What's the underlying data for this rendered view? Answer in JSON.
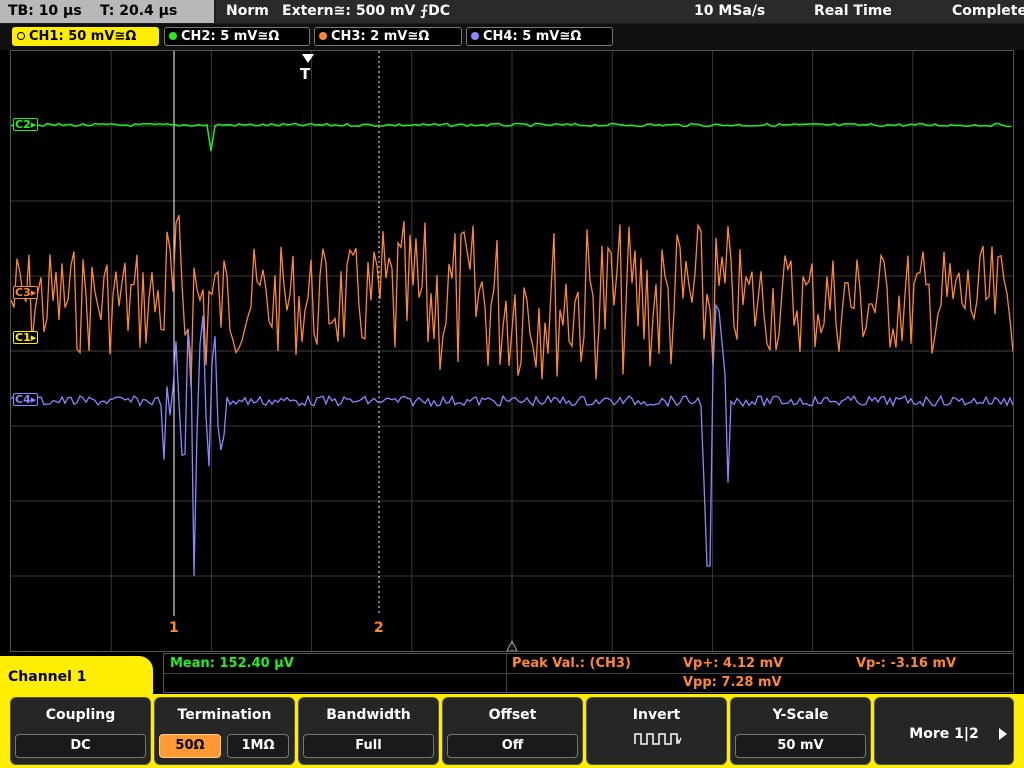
{
  "topbar": {
    "timebase": "TB: 10 µs",
    "trigger_time": "T: 20.4 µs",
    "mode": "Norm",
    "trigger_source": "Extern≅: 500 mV ⨍DC",
    "sample_rate": "10 MSa/s",
    "acq_mode": "Real Time",
    "status": "Complete"
  },
  "tabs": [
    {
      "label": "CH1: 50 mV≅Ω",
      "color": "#ffee00"
    },
    {
      "label": "CH2: 5 mV≅Ω",
      "color": "#22ee22"
    },
    {
      "label": "CH3: 2 mV≅Ω",
      "color": "#ff8833"
    },
    {
      "label": "CH4: 5 mV≅Ω",
      "color": "#8888ff"
    }
  ],
  "markers": {
    "ch2": "C2▸",
    "ch3": "C3▸",
    "ch1": "C1▸",
    "ch4": "C4▸"
  },
  "trigger_label": "T",
  "cursors": {
    "c1": "1",
    "c2": "2"
  },
  "channel_menu": "Channel 1",
  "measurements": {
    "mean": "Mean: 152.40 µV",
    "peak_label": "Peak Val.: (CH3)",
    "vp_plus": "Vp+: 4.12 mV",
    "vp_minus": "Vp-: -3.16 mV",
    "vpp": "Vpp: 7.28 mV"
  },
  "softkeys": {
    "coupling": {
      "title": "Coupling",
      "value": "DC"
    },
    "termination": {
      "title": "Termination",
      "opt1": "50Ω",
      "opt2": "1MΩ"
    },
    "bandwidth": {
      "title": "Bandwidth",
      "value": "Full"
    },
    "offset": {
      "title": "Offset",
      "value": "Off"
    },
    "invert": {
      "title": "Invert"
    },
    "yscale": {
      "title": "Y-Scale",
      "value": "50 mV"
    },
    "more": {
      "label": "More 1|2"
    }
  },
  "colors": {
    "ch1": "#ffee00",
    "ch2": "#22ee22",
    "ch3": "#ff8833",
    "ch4": "#8888ff",
    "accent": "#ffee00"
  }
}
